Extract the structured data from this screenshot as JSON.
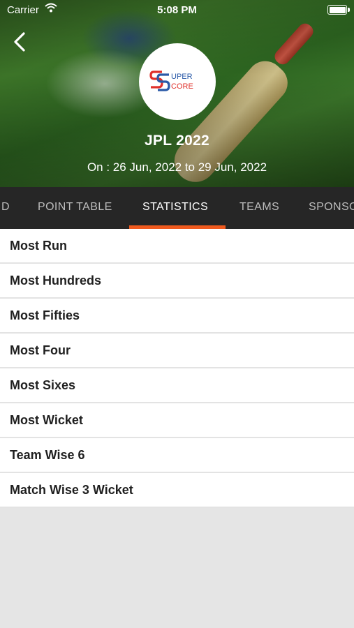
{
  "status_bar": {
    "carrier": "Carrier",
    "time": "5:08 PM"
  },
  "header": {
    "logo_text_top": "UPER",
    "logo_text_bottom": "CORE",
    "title": "JPL 2022",
    "dates": "On : 26 Jun, 2022 to 29 Jun, 2022"
  },
  "tabs": [
    {
      "label": "D"
    },
    {
      "label": "POINT TABLE"
    },
    {
      "label": "STATISTICS",
      "active": true
    },
    {
      "label": "TEAMS"
    },
    {
      "label": "SPONSORS"
    }
  ],
  "colors": {
    "accent": "#f05a1e",
    "tab_bar": "#262626",
    "logo_red": "#e0302a",
    "logo_blue": "#2a5aa8"
  },
  "statistics": [
    {
      "label": "Most Run"
    },
    {
      "label": "Most Hundreds"
    },
    {
      "label": "Most Fifties"
    },
    {
      "label": "Most Four"
    },
    {
      "label": "Most Sixes"
    },
    {
      "label": "Most Wicket"
    },
    {
      "label": "Team Wise 6"
    },
    {
      "label": "Match Wise 3 Wicket"
    }
  ]
}
